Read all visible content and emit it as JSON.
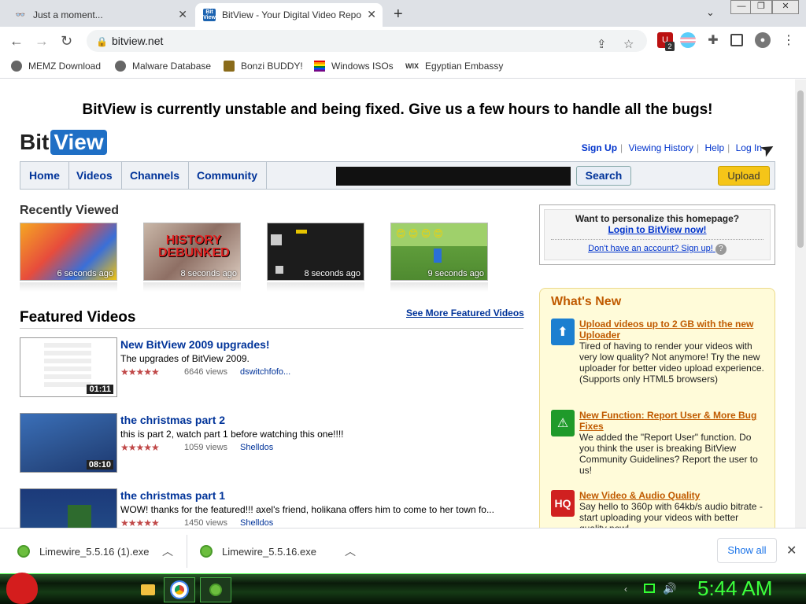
{
  "browser": {
    "tabs": [
      {
        "title": "Just a moment...",
        "icon": "glasses-icon"
      },
      {
        "title": "BitView - Your Digital Video Repo",
        "icon": "bitview-favicon"
      }
    ],
    "url": "bitview.net",
    "extension_badge": "2",
    "bookmarks": [
      {
        "label": "MEMZ Download"
      },
      {
        "label": "Malware Database"
      },
      {
        "label": "Bonzi BUDDY!"
      },
      {
        "label": "Windows ISOs"
      },
      {
        "label": "Egyptian Embassy"
      }
    ]
  },
  "site": {
    "banner": "BitView is currently unstable and being fixed. Give us a few hours to handle all the bugs!",
    "logo_bit": "Bit",
    "logo_view": "View",
    "toplinks": {
      "signup": "Sign Up",
      "history": "Viewing History",
      "help": "Help",
      "login": "Log In"
    },
    "nav": {
      "home": "Home",
      "videos": "Videos",
      "channels": "Channels",
      "community": "Community"
    },
    "search_button": "Search",
    "upload_button": "Upload",
    "recently_viewed": {
      "heading": "Recently Viewed",
      "items": [
        {
          "time": "6 seconds ago"
        },
        {
          "time": "8 seconds ago",
          "overlay": "HISTORY DEBUNKED"
        },
        {
          "time": "8 seconds ago"
        },
        {
          "time": "9 seconds ago"
        }
      ]
    },
    "featured": {
      "heading": "Featured Videos",
      "see_more": "See More Featured Videos",
      "videos": [
        {
          "title": "New BitView 2009 upgrades!",
          "desc": "The upgrades of BitView 2009.",
          "views": "6646 views",
          "user": "dswitchfofo...",
          "duration": "01:11",
          "stars": "★★★★★"
        },
        {
          "title": "the christmas part 2",
          "desc": "this is part 2, watch part 1 before watching this one!!!!",
          "views": "1059 views",
          "user": "Shelldos",
          "duration": "08:10",
          "stars": "★★★★★"
        },
        {
          "title": "the christmas part 1",
          "desc": "WOW! thanks for the featured!!! axel's friend, holikana offers him to come to her town fo...",
          "views": "1450 views",
          "user": "Shelldos",
          "duration": "",
          "stars": "★★★★★"
        }
      ]
    },
    "login_box": {
      "question": "Want to personalize this homepage?",
      "login_link": "Login to BitView now!",
      "signup_link": "Don't have an account? Sign up!"
    },
    "whats_new": {
      "heading": "What's New",
      "items": [
        {
          "title": "Upload videos up to 2 GB with the new Uploader",
          "body": "Tired of having to render your videos with very low quality? Not anymore! Try the new uploader for better video upload experience. (Supports only HTML5 browsers)",
          "icon": "upload-arrow-icon"
        },
        {
          "title": "New Function: Report User & More Bug Fixes",
          "body": "We added the \"Report User\" function. Do you think the user is breaking BitView Community Guidelines? Report the user to us!",
          "icon": "warning-icon"
        },
        {
          "title": "New Video & Audio Quality",
          "body": "Say hello to 360p with 64kb/s audio bitrate - start uploading your videos with better quality now!",
          "icon": "hq-icon",
          "icon_text": "HQ"
        }
      ]
    }
  },
  "downloads": {
    "items": [
      {
        "name": "Limewire_5.5.16 (1).exe"
      },
      {
        "name": "Limewire_5.5.16.exe"
      }
    ],
    "show_all": "Show all"
  },
  "taskbar": {
    "clock": "5:44 AM"
  },
  "colors": {
    "link_blue": "#003399",
    "upload_yellow": "#f5c518",
    "whatsnew_bg": "#fffbd9",
    "clock_green": "#3cff3c"
  }
}
